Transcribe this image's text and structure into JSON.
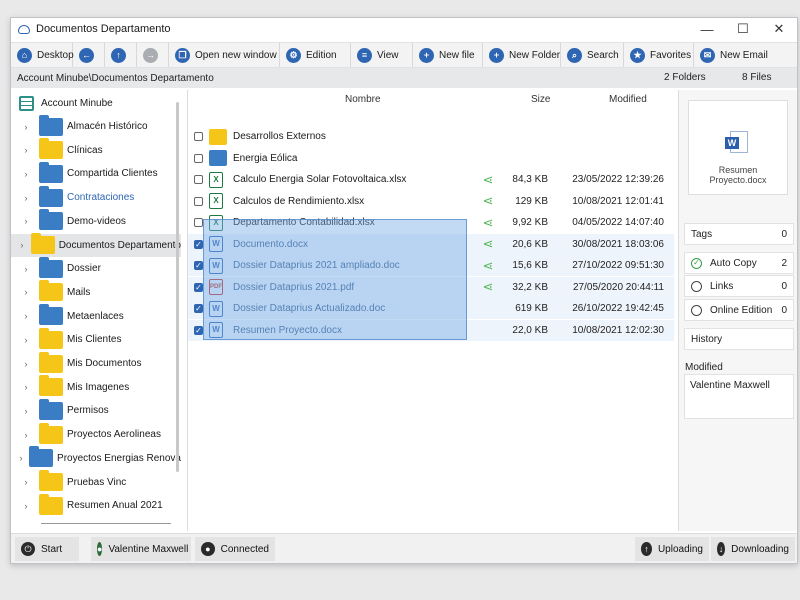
{
  "window": {
    "title": "Documentos Departamento",
    "controls": {
      "minimize": "—",
      "maximize": "☐",
      "close": "✕"
    }
  },
  "toolbar": {
    "desktop": "Desktop",
    "open_new_window": "Open new window",
    "edition": "Edition",
    "view": "View",
    "new_file": "New file",
    "new_folder": "New Folder",
    "search": "Search",
    "favorites": "Favorites",
    "new_email": "New Email"
  },
  "pathbar": {
    "path": "Account Minube\\Documentos Departamento",
    "folders": "2 Folders",
    "files": "8 Files"
  },
  "tree": {
    "root": "Account Minube",
    "items": [
      {
        "label": "Almacén Histórico",
        "color": "blue"
      },
      {
        "label": "Clínicas",
        "color": "yellow"
      },
      {
        "label": "Compartida Clientes",
        "color": "blue"
      },
      {
        "label": "Contrataciones",
        "color": "blue"
      },
      {
        "label": "Demo-videos",
        "color": "blue"
      },
      {
        "label": "Documentos Departamento",
        "color": "yellow"
      },
      {
        "label": "Dossier",
        "color": "blue"
      },
      {
        "label": "Mails",
        "color": "yellow"
      },
      {
        "label": "Metaenlaces",
        "color": "blue"
      },
      {
        "label": "Mis Clientes",
        "color": "yellow"
      },
      {
        "label": "Mis Documentos",
        "color": "yellow"
      },
      {
        "label": "Mis Imagenes",
        "color": "yellow"
      },
      {
        "label": "Permisos",
        "color": "blue"
      },
      {
        "label": "Proyectos Aerolineas",
        "color": "yellow"
      },
      {
        "label": "Proyectos Energias Renova",
        "color": "blue"
      },
      {
        "label": "Pruebas Vinc",
        "color": "yellow"
      },
      {
        "label": "Resumen Anual 2021",
        "color": "yellow"
      }
    ]
  },
  "files": {
    "columns": {
      "name": "Nombre",
      "size": "Size",
      "modified": "Modified"
    },
    "rows": [
      {
        "name": "Desarrollos Externos",
        "type": "folder-yellow",
        "size": "",
        "date": "",
        "shared": false,
        "checked": false
      },
      {
        "name": "Energia Eólica",
        "type": "folder-blue",
        "size": "",
        "date": "",
        "shared": false,
        "checked": false
      },
      {
        "name": "Calculo Energia Solar Fotovoltaica.xlsx",
        "type": "xlsx",
        "size": "84,3 KB",
        "date": "23/05/2022 12:39:26",
        "shared": true,
        "checked": false
      },
      {
        "name": "Calculos de Rendimiento.xlsx",
        "type": "xlsx",
        "size": "129 KB",
        "date": "10/08/2021 12:01:41",
        "shared": true,
        "checked": false
      },
      {
        "name": "Departamento Contabilidad.xlsx",
        "type": "xlsx",
        "size": "9,92 KB",
        "date": "04/05/2022 14:07:40",
        "shared": true,
        "checked": false
      },
      {
        "name": "Documento.docx",
        "type": "docx",
        "size": "20,6 KB",
        "date": "30/08/2021 18:03:06",
        "shared": true,
        "checked": true
      },
      {
        "name": "Dossier Dataprius 2021 ampliado.doc",
        "type": "docx",
        "size": "15,6 KB",
        "date": "27/10/2022 09:51:30",
        "shared": true,
        "checked": true
      },
      {
        "name": "Dossier Dataprius 2021.pdf",
        "type": "pdf",
        "size": "32,2 KB",
        "date": "27/05/2020 20:44:11",
        "shared": true,
        "checked": true
      },
      {
        "name": "Dossier Dataprius Actualizado.doc",
        "type": "docx",
        "size": "619 KB",
        "date": "26/10/2022 19:42:45",
        "shared": false,
        "checked": true
      },
      {
        "name": "Resumen Proyecto.docx",
        "type": "docx",
        "size": "22,0 KB",
        "date": "10/08/2021 12:02:30",
        "shared": false,
        "checked": true
      }
    ]
  },
  "details": {
    "preview_name": "Resumen Proyecto.docx",
    "tags_label": "Tags",
    "tags_count": "0",
    "auto_copy_label": "Auto Copy",
    "auto_copy_count": "2",
    "links_label": "Links",
    "links_count": "0",
    "online_edition_label": "Online Edition",
    "online_edition_count": "0",
    "history_label": "History",
    "modified_label": "Modified",
    "modified_by": "Valentine Maxwell"
  },
  "status": {
    "start": "Start",
    "user": "Valentine Maxwell",
    "connection": "Connected",
    "uploading": "Uploading",
    "downloading": "Downloading"
  }
}
